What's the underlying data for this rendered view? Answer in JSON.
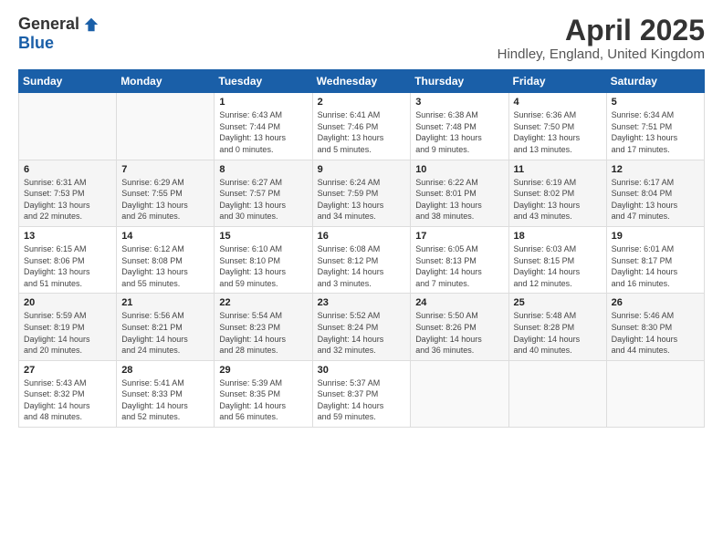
{
  "logo": {
    "general": "General",
    "blue": "Blue"
  },
  "title": "April 2025",
  "location": "Hindley, England, United Kingdom",
  "days_header": [
    "Sunday",
    "Monday",
    "Tuesday",
    "Wednesday",
    "Thursday",
    "Friday",
    "Saturday"
  ],
  "weeks": [
    [
      {
        "num": "",
        "info": ""
      },
      {
        "num": "",
        "info": ""
      },
      {
        "num": "1",
        "info": "Sunrise: 6:43 AM\nSunset: 7:44 PM\nDaylight: 13 hours\nand 0 minutes."
      },
      {
        "num": "2",
        "info": "Sunrise: 6:41 AM\nSunset: 7:46 PM\nDaylight: 13 hours\nand 5 minutes."
      },
      {
        "num": "3",
        "info": "Sunrise: 6:38 AM\nSunset: 7:48 PM\nDaylight: 13 hours\nand 9 minutes."
      },
      {
        "num": "4",
        "info": "Sunrise: 6:36 AM\nSunset: 7:50 PM\nDaylight: 13 hours\nand 13 minutes."
      },
      {
        "num": "5",
        "info": "Sunrise: 6:34 AM\nSunset: 7:51 PM\nDaylight: 13 hours\nand 17 minutes."
      }
    ],
    [
      {
        "num": "6",
        "info": "Sunrise: 6:31 AM\nSunset: 7:53 PM\nDaylight: 13 hours\nand 22 minutes."
      },
      {
        "num": "7",
        "info": "Sunrise: 6:29 AM\nSunset: 7:55 PM\nDaylight: 13 hours\nand 26 minutes."
      },
      {
        "num": "8",
        "info": "Sunrise: 6:27 AM\nSunset: 7:57 PM\nDaylight: 13 hours\nand 30 minutes."
      },
      {
        "num": "9",
        "info": "Sunrise: 6:24 AM\nSunset: 7:59 PM\nDaylight: 13 hours\nand 34 minutes."
      },
      {
        "num": "10",
        "info": "Sunrise: 6:22 AM\nSunset: 8:01 PM\nDaylight: 13 hours\nand 38 minutes."
      },
      {
        "num": "11",
        "info": "Sunrise: 6:19 AM\nSunset: 8:02 PM\nDaylight: 13 hours\nand 43 minutes."
      },
      {
        "num": "12",
        "info": "Sunrise: 6:17 AM\nSunset: 8:04 PM\nDaylight: 13 hours\nand 47 minutes."
      }
    ],
    [
      {
        "num": "13",
        "info": "Sunrise: 6:15 AM\nSunset: 8:06 PM\nDaylight: 13 hours\nand 51 minutes."
      },
      {
        "num": "14",
        "info": "Sunrise: 6:12 AM\nSunset: 8:08 PM\nDaylight: 13 hours\nand 55 minutes."
      },
      {
        "num": "15",
        "info": "Sunrise: 6:10 AM\nSunset: 8:10 PM\nDaylight: 13 hours\nand 59 minutes."
      },
      {
        "num": "16",
        "info": "Sunrise: 6:08 AM\nSunset: 8:12 PM\nDaylight: 14 hours\nand 3 minutes."
      },
      {
        "num": "17",
        "info": "Sunrise: 6:05 AM\nSunset: 8:13 PM\nDaylight: 14 hours\nand 7 minutes."
      },
      {
        "num": "18",
        "info": "Sunrise: 6:03 AM\nSunset: 8:15 PM\nDaylight: 14 hours\nand 12 minutes."
      },
      {
        "num": "19",
        "info": "Sunrise: 6:01 AM\nSunset: 8:17 PM\nDaylight: 14 hours\nand 16 minutes."
      }
    ],
    [
      {
        "num": "20",
        "info": "Sunrise: 5:59 AM\nSunset: 8:19 PM\nDaylight: 14 hours\nand 20 minutes."
      },
      {
        "num": "21",
        "info": "Sunrise: 5:56 AM\nSunset: 8:21 PM\nDaylight: 14 hours\nand 24 minutes."
      },
      {
        "num": "22",
        "info": "Sunrise: 5:54 AM\nSunset: 8:23 PM\nDaylight: 14 hours\nand 28 minutes."
      },
      {
        "num": "23",
        "info": "Sunrise: 5:52 AM\nSunset: 8:24 PM\nDaylight: 14 hours\nand 32 minutes."
      },
      {
        "num": "24",
        "info": "Sunrise: 5:50 AM\nSunset: 8:26 PM\nDaylight: 14 hours\nand 36 minutes."
      },
      {
        "num": "25",
        "info": "Sunrise: 5:48 AM\nSunset: 8:28 PM\nDaylight: 14 hours\nand 40 minutes."
      },
      {
        "num": "26",
        "info": "Sunrise: 5:46 AM\nSunset: 8:30 PM\nDaylight: 14 hours\nand 44 minutes."
      }
    ],
    [
      {
        "num": "27",
        "info": "Sunrise: 5:43 AM\nSunset: 8:32 PM\nDaylight: 14 hours\nand 48 minutes."
      },
      {
        "num": "28",
        "info": "Sunrise: 5:41 AM\nSunset: 8:33 PM\nDaylight: 14 hours\nand 52 minutes."
      },
      {
        "num": "29",
        "info": "Sunrise: 5:39 AM\nSunset: 8:35 PM\nDaylight: 14 hours\nand 56 minutes."
      },
      {
        "num": "30",
        "info": "Sunrise: 5:37 AM\nSunset: 8:37 PM\nDaylight: 14 hours\nand 59 minutes."
      },
      {
        "num": "",
        "info": ""
      },
      {
        "num": "",
        "info": ""
      },
      {
        "num": "",
        "info": ""
      }
    ]
  ]
}
